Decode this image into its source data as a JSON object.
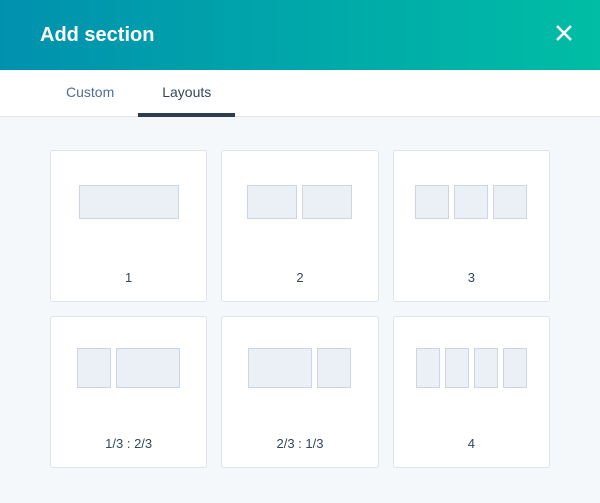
{
  "header": {
    "title": "Add section"
  },
  "tabs": [
    {
      "label": "Custom",
      "active": false
    },
    {
      "label": "Layouts",
      "active": true
    }
  ],
  "layouts": [
    {
      "label": "1"
    },
    {
      "label": "2"
    },
    {
      "label": "3"
    },
    {
      "label": "1/3 : 2/3"
    },
    {
      "label": "2/3 : 1/3"
    },
    {
      "label": "4"
    }
  ]
}
